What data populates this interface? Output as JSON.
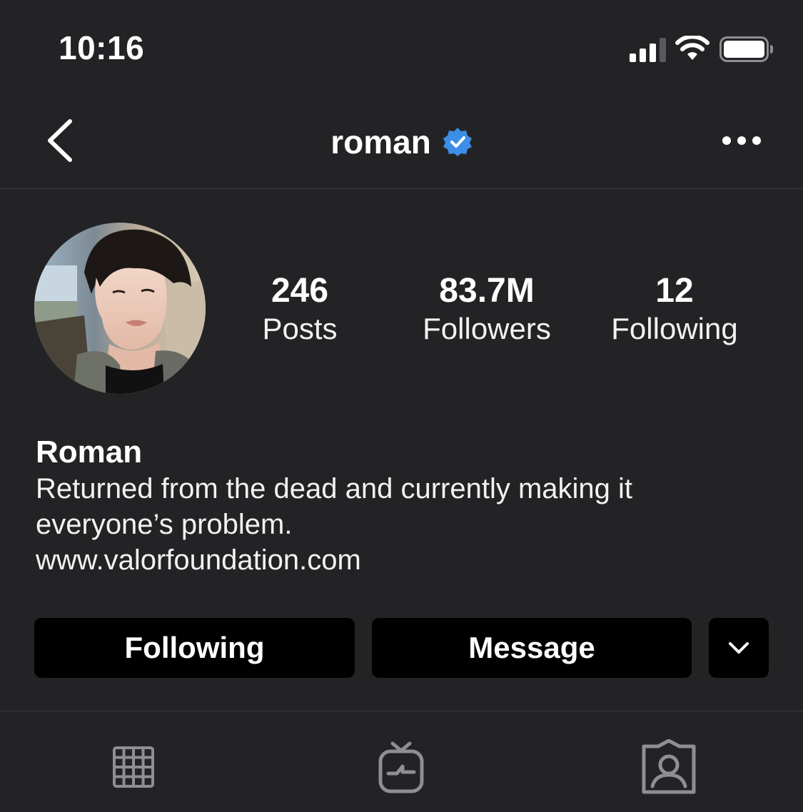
{
  "status_bar": {
    "time": "10:16"
  },
  "nav": {
    "username": "roman",
    "verified": true
  },
  "profile": {
    "stats": [
      {
        "value": "246",
        "label": "Posts"
      },
      {
        "value": "83.7M",
        "label": "Followers"
      },
      {
        "value": "12",
        "label": "Following"
      }
    ],
    "name": "Roman",
    "bio_lines": [
      "Returned from the dead and currently making it",
      "everyone’s problem."
    ],
    "website": "www.valorfoundation.com"
  },
  "actions": {
    "following_label": "Following",
    "message_label": "Message"
  },
  "tabs": [
    "grid-icon",
    "igtv-icon",
    "tagged-icon"
  ],
  "colors": {
    "background": "#232326",
    "button": "#000000",
    "verified": "#3c8ee6",
    "icon_gray": "#8e8e93"
  }
}
